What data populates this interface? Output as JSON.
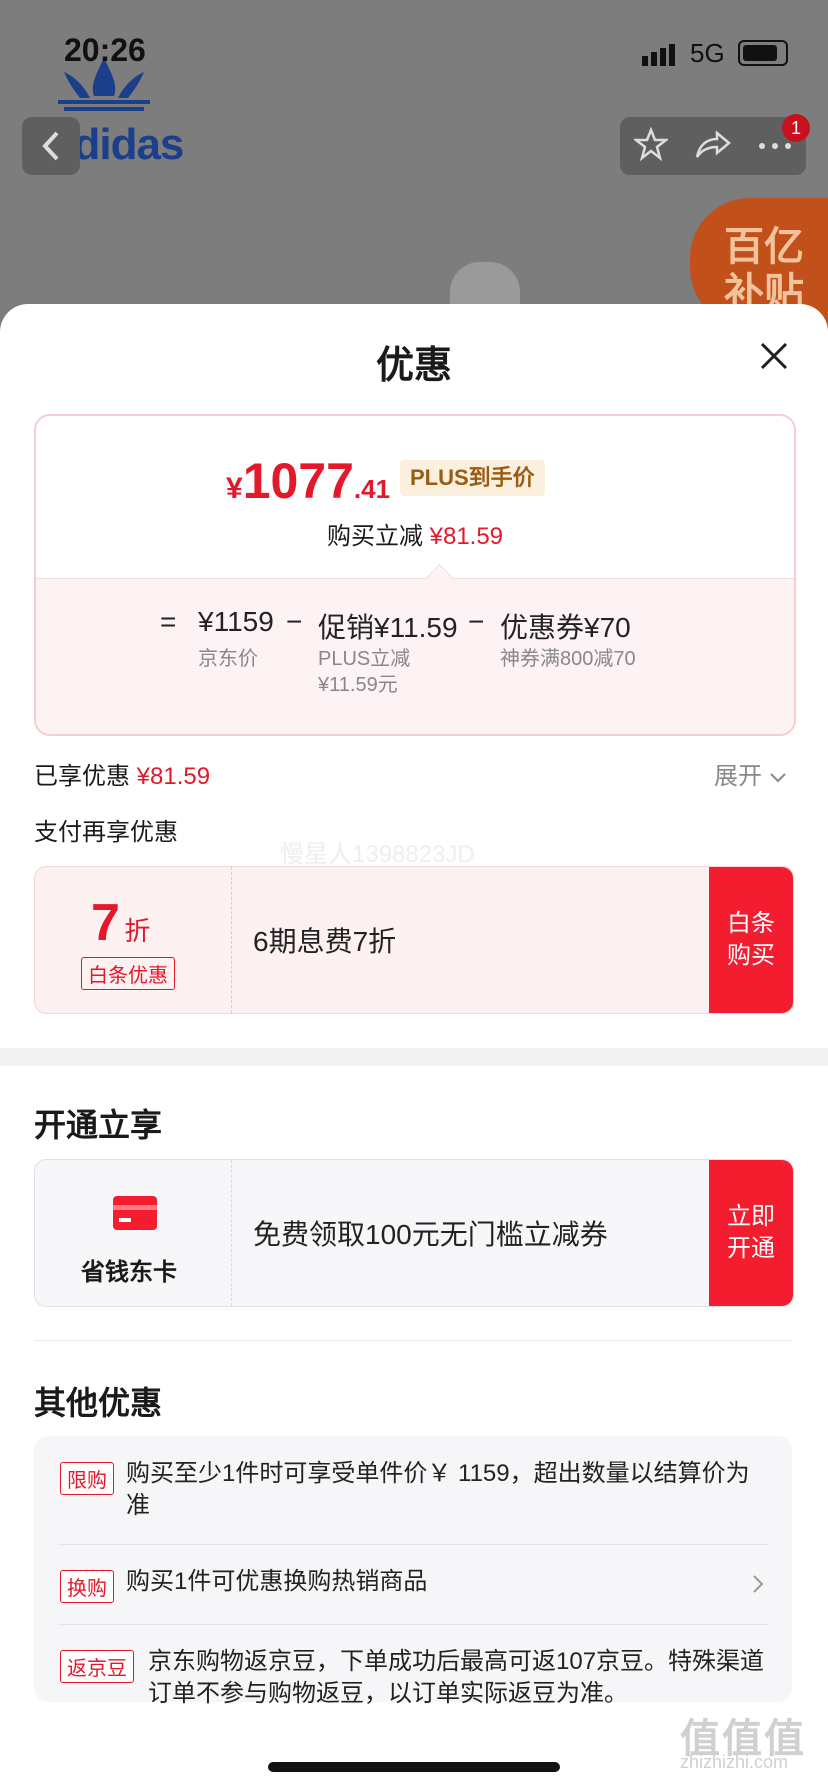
{
  "status_bar": {
    "time": "20:26",
    "network": "5G"
  },
  "background": {
    "brand_logo": "adidas",
    "cart_badge": "1",
    "subsidy_badge_line1": "百亿",
    "subsidy_badge_line2": "补贴"
  },
  "sheet": {
    "title": "优惠",
    "price_card": {
      "currency": "¥",
      "price_integer": "1077",
      "price_decimal": ".41",
      "plus_tag": "PLUS到手价",
      "reduce_label": "购买立减",
      "reduce_amount": "¥81.59",
      "eq": "=",
      "base_price": "¥1159",
      "base_price_label": "京东价",
      "minus1": "−",
      "promo": "促销¥11.59",
      "promo_sub1": "PLUS立减",
      "promo_sub2": "¥11.59元",
      "minus2": "−",
      "coupon": "优惠券¥70",
      "coupon_sub": "神券满800减70"
    },
    "enjoyed_label": "已享优惠",
    "enjoyed_amount": "¥81.59",
    "expand_label": "展开",
    "pay_section_title": "支付再享优惠",
    "watermark_faint": "慢星人1398823JD",
    "baitiao": {
      "discount_num": "7",
      "discount_unit": "折",
      "tag": "白条优惠",
      "desc": "6期息费7折",
      "button_line1": "白条",
      "button_line2": "购买"
    },
    "open_section_title": "开通立享",
    "card_offer": {
      "card_name": "省钱东卡",
      "desc": "免费领取100元无门槛立减券",
      "button_line1": "立即",
      "button_line2": "开通"
    },
    "other_section_title": "其他优惠",
    "other_items": [
      {
        "tag": "限购",
        "text": "购买至少1件时可享受单件价￥ 1159，超出数量以结算价为准"
      },
      {
        "tag": "换购",
        "text": "购买1件可优惠换购热销商品"
      },
      {
        "tag": "返京豆",
        "text": "京东购物返京豆，下单成功后最高可返107京豆。特殊渠道订单不参与购物返豆，以订单实际返豆为准。"
      }
    ]
  },
  "site_watermark": {
    "logo": "值值值",
    "url": "zhizhizhi.com"
  },
  "colors": {
    "accent_red": "#e4182b",
    "button_red": "#f41c2f",
    "plus_gold": "#9a5b14"
  }
}
